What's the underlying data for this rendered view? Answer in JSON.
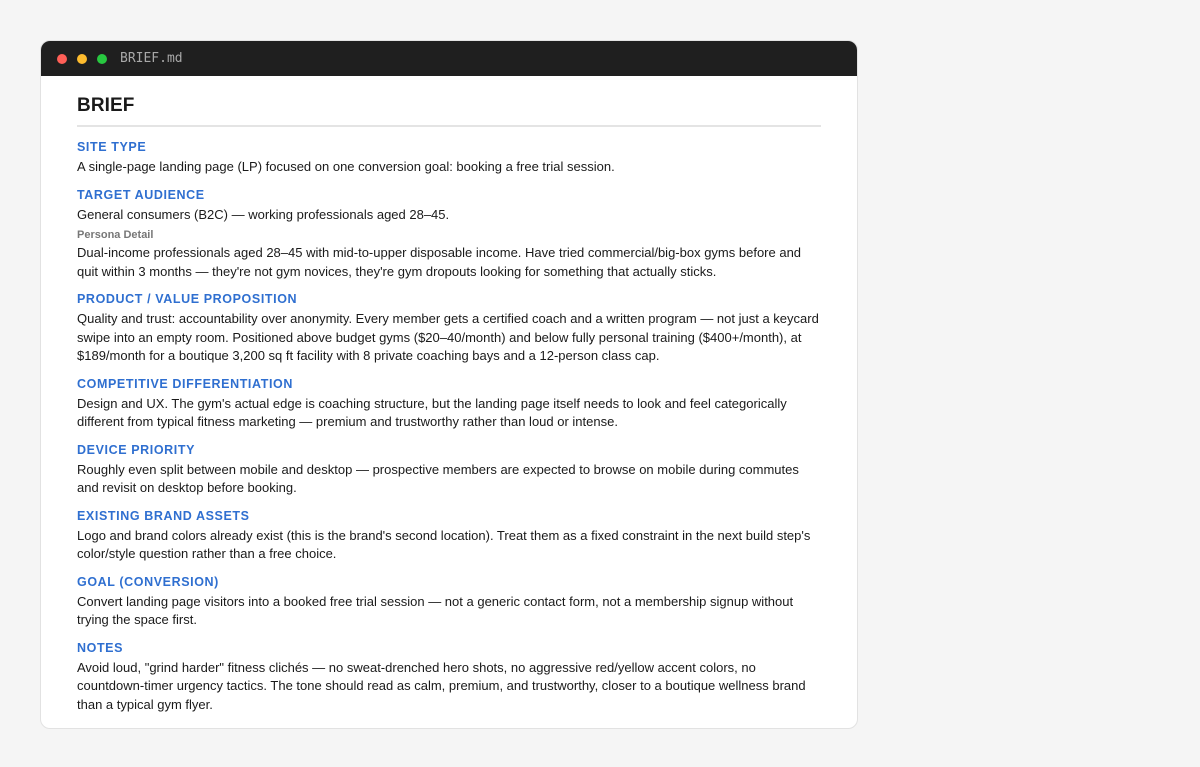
{
  "window": {
    "title": "BRIEF.md",
    "controls": [
      {
        "name": "close",
        "color": "#ff5f57"
      },
      {
        "name": "minimize",
        "color": "#febc2e"
      },
      {
        "name": "zoom",
        "color": "#28c840"
      }
    ]
  },
  "colors": {
    "heading_accent": "#2f6fd0",
    "text": "#1a1a1a",
    "subheading": "#777777"
  },
  "document": {
    "title": "BRIEF",
    "sections": [
      {
        "heading": "SITE TYPE",
        "body": "A single-page landing page (LP) focused on one conversion goal: booking a free trial session."
      },
      {
        "heading": "TARGET AUDIENCE",
        "body": "General consumers (B2C) — working professionals aged 28–45.",
        "subheading": "Persona Detail",
        "subbody": "Dual-income professionals aged 28–45 with mid-to-upper disposable income. Have tried commercial/big-box gyms before and quit within 3 months — they're not gym novices, they're gym dropouts looking for something that actually sticks."
      },
      {
        "heading": "PRODUCT / VALUE PROPOSITION",
        "body": "Quality and trust: accountability over anonymity. Every member gets a certified coach and a written program — not just a keycard swipe into an empty room. Positioned above budget gyms ($20–40/month) and below fully personal training ($400+/month), at $189/month for a boutique 3,200 sq ft facility with 8 private coaching bays and a 12-person class cap."
      },
      {
        "heading": "COMPETITIVE DIFFERENTIATION",
        "body": "Design and UX. The gym's actual edge is coaching structure, but the landing page itself needs to look and feel categorically different from typical fitness marketing — premium and trustworthy rather than loud or intense."
      },
      {
        "heading": "DEVICE PRIORITY",
        "body": "Roughly even split between mobile and desktop — prospective members are expected to browse on mobile during commutes and revisit on desktop before booking."
      },
      {
        "heading": "EXISTING BRAND ASSETS",
        "body": "Logo and brand colors already exist (this is the brand's second location). Treat them as a fixed constraint in the next build step's color/style question rather than a free choice."
      },
      {
        "heading": "GOAL (CONVERSION)",
        "body": "Convert landing page visitors into a booked free trial session — not a generic contact form, not a membership signup without trying the space first."
      },
      {
        "heading": "NOTES",
        "body": "Avoid loud, \"grind harder\" fitness clichés — no sweat-drenched hero shots, no aggressive red/yellow accent colors, no countdown-timer urgency tactics. The tone should read as calm, premium, and trustworthy, closer to a boutique wellness brand than a typical gym flyer."
      }
    ]
  }
}
